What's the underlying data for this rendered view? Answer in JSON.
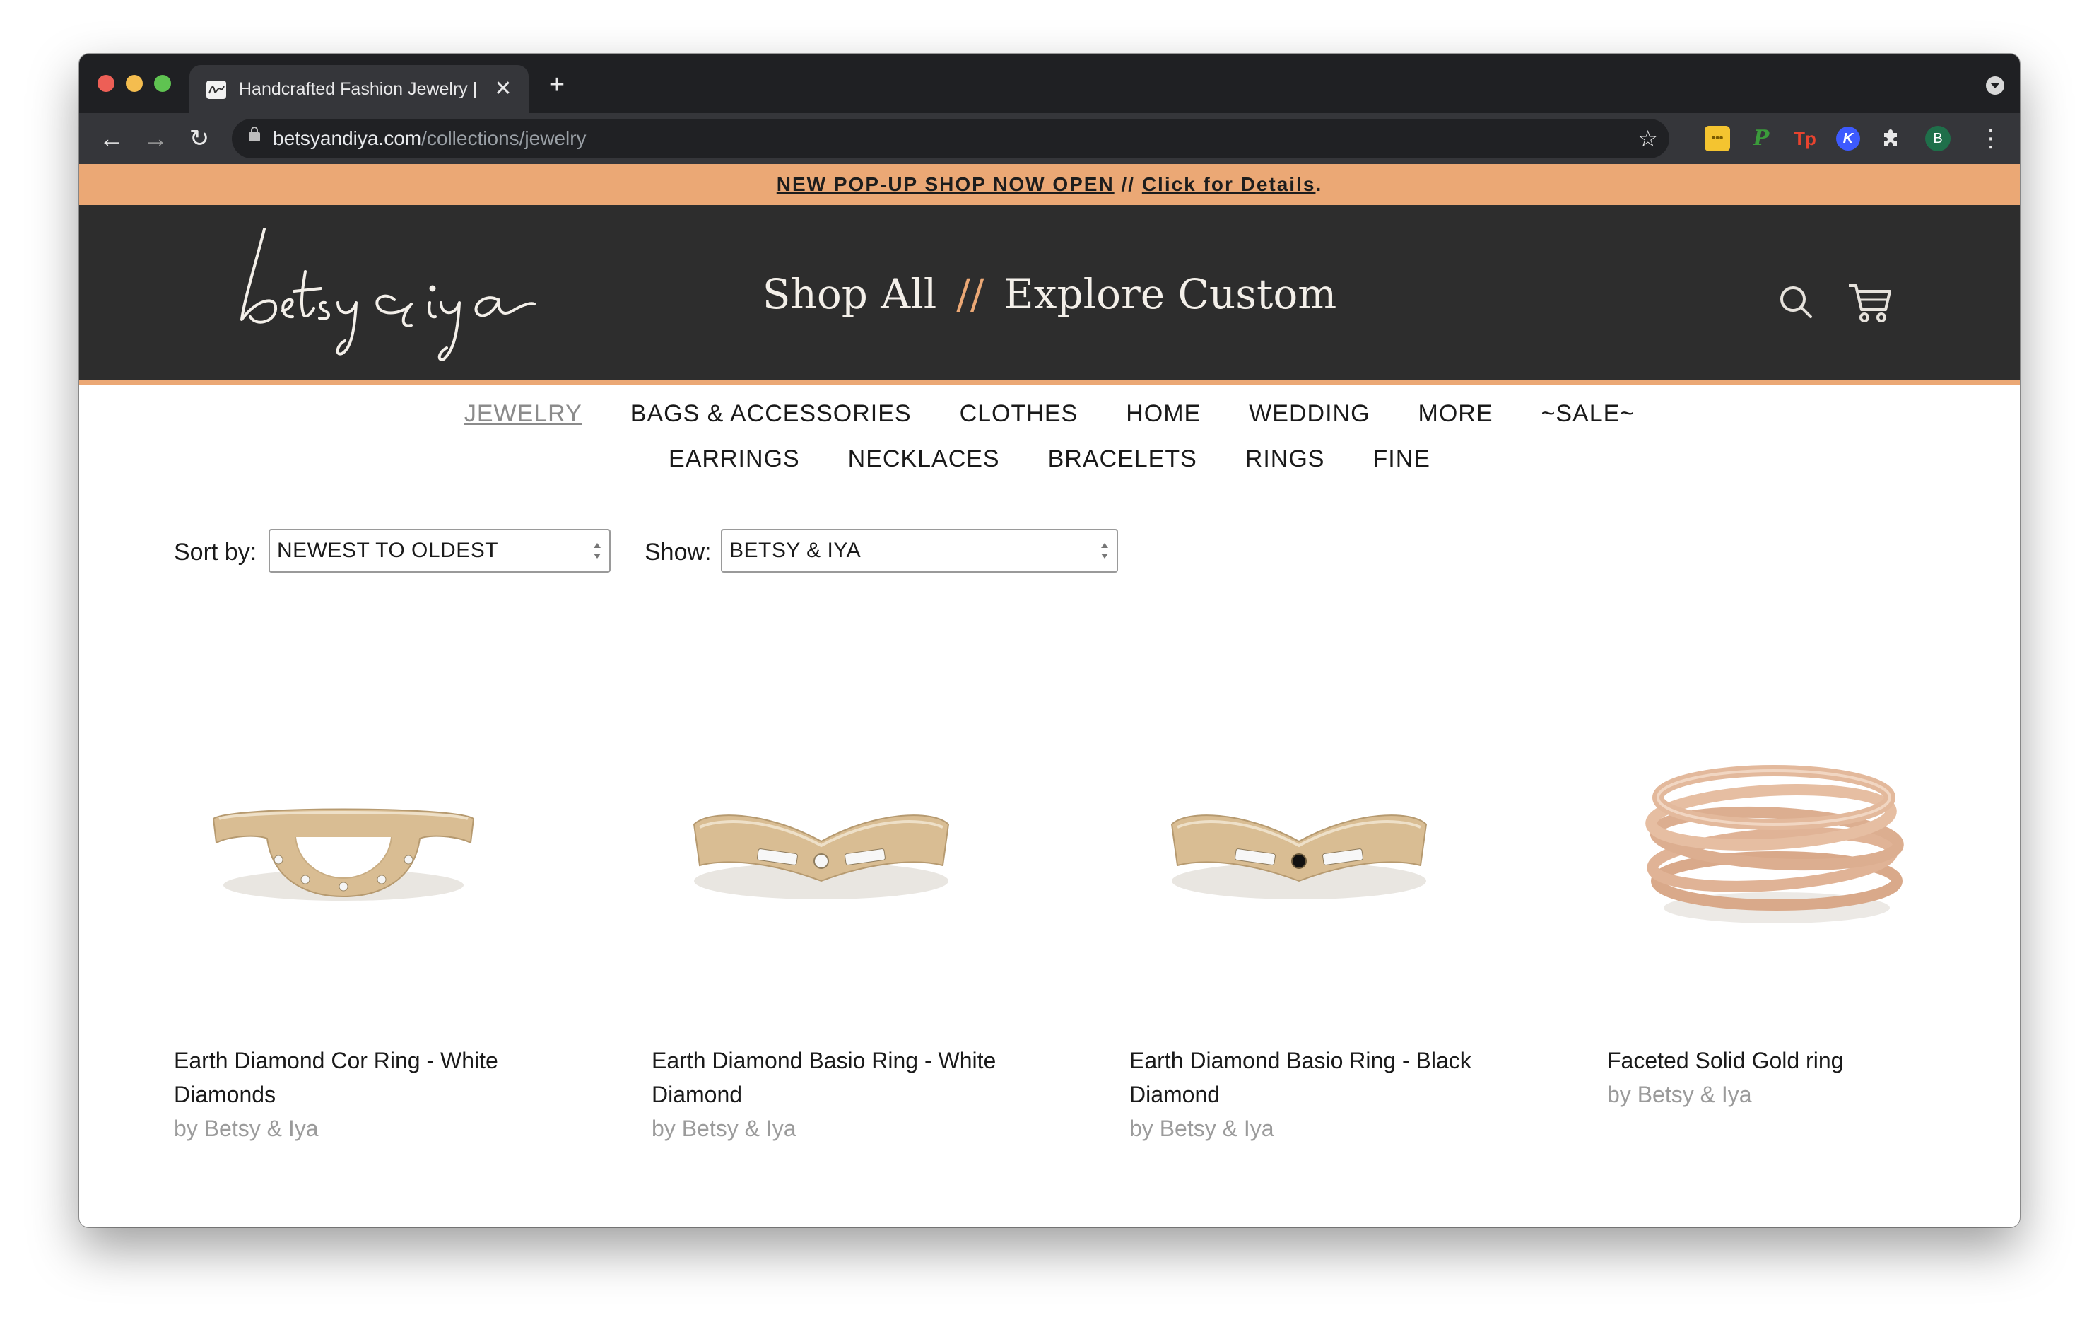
{
  "browser": {
    "tab_title": "Handcrafted Fashion Jewelry |",
    "tab_close": "✕",
    "new_tab": "+",
    "url_host": "betsyandiya.com",
    "url_path": "/collections/jewelry",
    "profile_initial": "B",
    "extensions": [
      "notes-extension",
      "p-extension",
      "tp-extension",
      "k-extension",
      "puzzle-icon"
    ],
    "ext_labels": {
      "yellow": "•••",
      "p": "P",
      "tp": "Tp",
      "k": "K"
    }
  },
  "announcement": {
    "part1": "NEW POP-UP SHOP NOW OPEN",
    "sep": " // ",
    "part2": "Click for Details",
    "end": "."
  },
  "header": {
    "logo_text": "betsy & iya",
    "nav_shop": "Shop All",
    "nav_sep": "//",
    "nav_custom": "Explore Custom"
  },
  "categories": {
    "primary": [
      "JEWELRY",
      "BAGS & ACCESSORIES",
      "CLOTHES",
      "HOME",
      "WEDDING",
      "MORE",
      "~SALE~"
    ],
    "secondary": [
      "EARRINGS",
      "NECKLACES",
      "BRACELETS",
      "RINGS",
      "FINE"
    ]
  },
  "filters": {
    "sort_label": "Sort by:",
    "sort_value": "NEWEST TO OLDEST",
    "show_label": "Show:",
    "show_value": "BETSY & IYA"
  },
  "products": [
    {
      "name": "Earth Diamond Cor Ring - White Diamonds",
      "by": "by Betsy & Iya"
    },
    {
      "name": "Earth Diamond Basio Ring - White Diamond",
      "by": "by Betsy & Iya"
    },
    {
      "name": "Earth Diamond Basio Ring - Black Diamond",
      "by": "by Betsy & Iya"
    },
    {
      "name": "Faceted Solid Gold ring",
      "by": "by Betsy & Iya"
    }
  ],
  "colors": {
    "accent": "#eba875",
    "header_bg": "#2d2d2d",
    "gold": "#d9bd93"
  }
}
